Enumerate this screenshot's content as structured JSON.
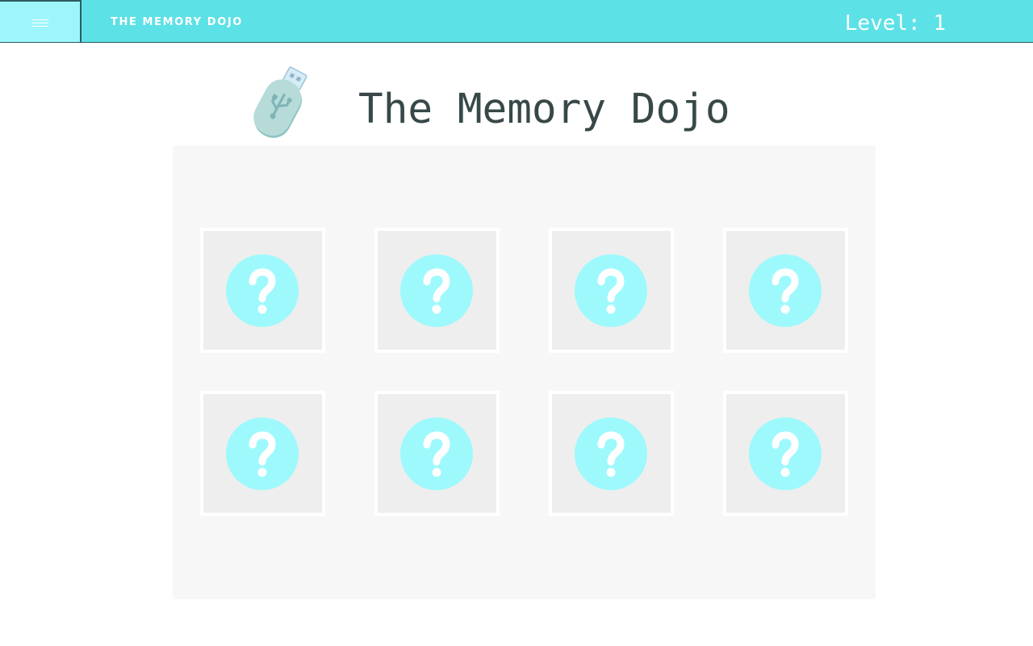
{
  "header": {
    "brand": "THE MEMORY DOJO",
    "level_label": "Level: 1",
    "menu_icon": "hamburger-icon"
  },
  "main": {
    "title": "The Memory Dojo",
    "logo_icon": "usb-drive-icon"
  },
  "board": {
    "cards": [
      {
        "state": "face-down",
        "icon": "question-mark-icon"
      },
      {
        "state": "face-down",
        "icon": "question-mark-icon"
      },
      {
        "state": "face-down",
        "icon": "question-mark-icon"
      },
      {
        "state": "face-down",
        "icon": "question-mark-icon"
      },
      {
        "state": "face-down",
        "icon": "question-mark-icon"
      },
      {
        "state": "face-down",
        "icon": "question-mark-icon"
      },
      {
        "state": "face-down",
        "icon": "question-mark-icon"
      },
      {
        "state": "face-down",
        "icon": "question-mark-icon"
      }
    ]
  },
  "colors": {
    "topbar": "#5ce1e6",
    "menu_button": "#9ef6fb",
    "card_icon": "#9ef9fc",
    "title_text": "#384848"
  }
}
